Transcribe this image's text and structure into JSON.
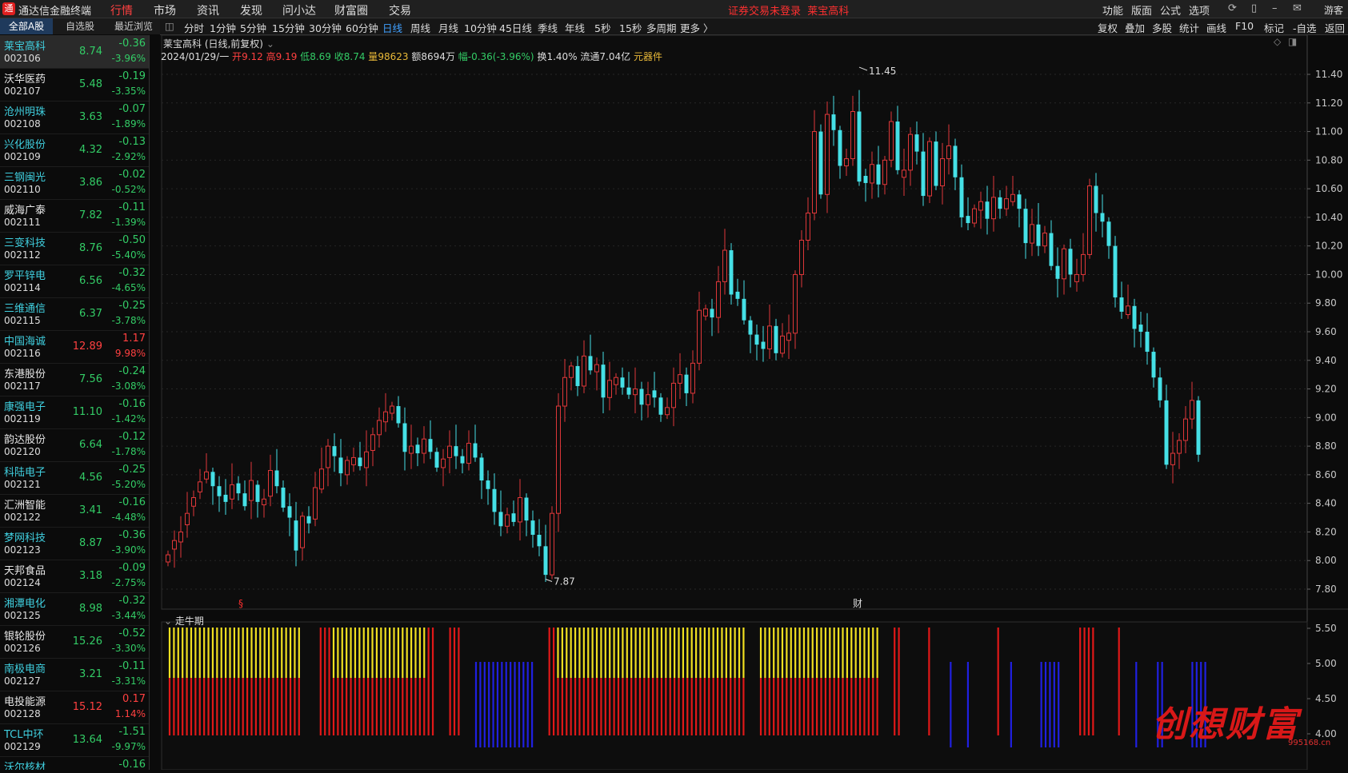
{
  "app": {
    "title": "通达信金融终端",
    "notice": "证券交易未登录",
    "notice_stock": "莱宝高科",
    "guest": "游客"
  },
  "menu": [
    "行情",
    "市场",
    "资讯",
    "发现",
    "问小达",
    "财富圈",
    "交易"
  ],
  "right_menu": [
    "功能",
    "版面",
    "公式",
    "选项"
  ],
  "list_tabs": [
    "全部A股",
    "自选股",
    "最近浏览"
  ],
  "stocks": [
    {
      "name": "莱宝高科",
      "code": "002106",
      "price": "8.74",
      "change": "-0.36",
      "pct": "-3.96%",
      "dir": "down",
      "name_color": "cyan"
    },
    {
      "name": "沃华医药",
      "code": "002107",
      "price": "5.48",
      "change": "-0.19",
      "pct": "-3.35%",
      "dir": "down",
      "name_color": "white"
    },
    {
      "name": "沧州明珠",
      "code": "002108",
      "price": "3.63",
      "change": "-0.07",
      "pct": "-1.89%",
      "dir": "down",
      "name_color": "cyan"
    },
    {
      "name": "兴化股份",
      "code": "002109",
      "price": "4.32",
      "change": "-0.13",
      "pct": "-2.92%",
      "dir": "down",
      "name_color": "cyan"
    },
    {
      "name": "三钢闽光",
      "code": "002110",
      "price": "3.86",
      "change": "-0.02",
      "pct": "-0.52%",
      "dir": "down",
      "name_color": "cyan"
    },
    {
      "name": "威海广泰",
      "code": "002111",
      "price": "7.82",
      "change": "-0.11",
      "pct": "-1.39%",
      "dir": "down",
      "name_color": "white"
    },
    {
      "name": "三变科技",
      "code": "002112",
      "price": "8.76",
      "change": "-0.50",
      "pct": "-5.40%",
      "dir": "down",
      "name_color": "cyan"
    },
    {
      "name": "罗平锌电",
      "code": "002114",
      "price": "6.56",
      "change": "-0.32",
      "pct": "-4.65%",
      "dir": "down",
      "name_color": "cyan"
    },
    {
      "name": "三维通信",
      "code": "002115",
      "price": "6.37",
      "change": "-0.25",
      "pct": "-3.78%",
      "dir": "down",
      "name_color": "cyan"
    },
    {
      "name": "中国海诚",
      "code": "002116",
      "price": "12.89",
      "change": "1.17",
      "pct": "9.98%",
      "dir": "up",
      "name_color": "cyan"
    },
    {
      "name": "东港股份",
      "code": "002117",
      "price": "7.56",
      "change": "-0.24",
      "pct": "-3.08%",
      "dir": "down",
      "name_color": "white"
    },
    {
      "name": "康强电子",
      "code": "002119",
      "price": "11.10",
      "change": "-0.16",
      "pct": "-1.42%",
      "dir": "down",
      "name_color": "cyan"
    },
    {
      "name": "韵达股份",
      "code": "002120",
      "price": "6.64",
      "change": "-0.12",
      "pct": "-1.78%",
      "dir": "down",
      "name_color": "white"
    },
    {
      "name": "科陆电子",
      "code": "002121",
      "price": "4.56",
      "change": "-0.25",
      "pct": "-5.20%",
      "dir": "down",
      "name_color": "cyan"
    },
    {
      "name": "汇洲智能",
      "code": "002122",
      "price": "3.41",
      "change": "-0.16",
      "pct": "-4.48%",
      "dir": "down",
      "name_color": "white"
    },
    {
      "name": "梦网科技",
      "code": "002123",
      "price": "8.87",
      "change": "-0.36",
      "pct": "-3.90%",
      "dir": "down",
      "name_color": "cyan"
    },
    {
      "name": "天邦食品",
      "code": "002124",
      "price": "3.18",
      "change": "-0.09",
      "pct": "-2.75%",
      "dir": "down",
      "name_color": "white"
    },
    {
      "name": "湘潭电化",
      "code": "002125",
      "price": "8.98",
      "change": "-0.32",
      "pct": "-3.44%",
      "dir": "down",
      "name_color": "cyan"
    },
    {
      "name": "银轮股份",
      "code": "002126",
      "price": "15.26",
      "change": "-0.52",
      "pct": "-3.30%",
      "dir": "down",
      "name_color": "white"
    },
    {
      "name": "南极电商",
      "code": "002127",
      "price": "3.21",
      "change": "-0.11",
      "pct": "-3.31%",
      "dir": "down",
      "name_color": "cyan"
    },
    {
      "name": "电投能源",
      "code": "002128",
      "price": "15.12",
      "change": "0.17",
      "pct": "1.14%",
      "dir": "up",
      "name_color": "white"
    },
    {
      "name": "TCL中环",
      "code": "002129",
      "price": "13.64",
      "change": "-1.51",
      "pct": "-9.97%",
      "dir": "down",
      "name_color": "cyan"
    },
    {
      "name": "沃尔核材",
      "code": "",
      "price": "",
      "change": "-0.16",
      "pct": "",
      "dir": "down",
      "name_color": "cyan"
    }
  ],
  "periods": [
    "分时",
    "1分钟",
    "5分钟",
    "15分钟",
    "30分钟",
    "60分钟",
    "日线",
    "周线",
    "月线",
    "10分钟",
    "45日线",
    "季线",
    "年线",
    "5秒",
    "15秒",
    "多周期",
    "更多 〉"
  ],
  "active_period": "日线",
  "toolbar_right": [
    "复权",
    "叠加",
    "多股",
    "统计",
    "画线",
    "F10",
    "标记",
    "-自选",
    "返回"
  ],
  "chart_title": "莱宝高科 (日线,前复权)",
  "info": {
    "date": "2024/01/29/一",
    "open_label": "开",
    "open": "9.12",
    "high_label": "高",
    "high": "9.19",
    "low_label": "低",
    "low": "8.69",
    "close_label": "收",
    "close": "8.74",
    "vol_label": "量",
    "vol": "98623",
    "amt_label": "额",
    "amt": "8694万",
    "amp_label": "幅",
    "amp": "-0.36(-3.96%)",
    "turn_label": "换",
    "turn": "1.40%",
    "float_label": "流通",
    "float": "7.04亿",
    "sector": "元器件"
  },
  "indicator": {
    "name": "走牛期",
    "ticks": [
      "5.50",
      "5.00",
      "4.50",
      "4.00"
    ]
  },
  "markers": {
    "s": "§",
    "cai": "财"
  },
  "watermark": {
    "text": "创想财富",
    "url": "995168.cn"
  },
  "chart_data": {
    "type": "candlestick",
    "ylim": [
      7.72,
      11.62
    ],
    "yticks": [
      "11.40",
      "11.20",
      "11.00",
      "10.80",
      "10.60",
      "10.40",
      "10.20",
      "10.00",
      "9.80",
      "9.60",
      "9.40",
      "9.20",
      "9.00",
      "8.80",
      "8.60",
      "8.40",
      "8.20",
      "8.00",
      "7.80"
    ],
    "annotations": [
      {
        "label": "11.45",
        "value": 11.45
      },
      {
        "label": "7.87",
        "value": 7.87
      }
    ],
    "closes": [
      8.04,
      8.14,
      8.2,
      8.33,
      8.44,
      8.55,
      8.62,
      8.52,
      8.45,
      8.41,
      8.53,
      8.47,
      8.38,
      8.56,
      8.41,
      8.43,
      8.63,
      8.52,
      8.37,
      8.3,
      8.07,
      8.31,
      8.26,
      8.51,
      8.64,
      8.8,
      8.73,
      8.61,
      8.7,
      8.72,
      8.66,
      8.76,
      8.88,
      8.98,
      9.04,
      9.08,
      8.96,
      8.76,
      8.8,
      8.75,
      8.85,
      8.76,
      8.65,
      8.71,
      8.8,
      8.73,
      8.68,
      8.82,
      8.72,
      8.56,
      8.5,
      8.34,
      8.24,
      8.32,
      8.27,
      8.44,
      8.28,
      8.18,
      8.1,
      7.9,
      8.33,
      9.08,
      9.28,
      9.36,
      9.22,
      9.43,
      9.33,
      9.37,
      9.14,
      9.26,
      9.28,
      9.21,
      9.16,
      9.2,
      9.09,
      9.16,
      9.14,
      9.02,
      9.07,
      9.24,
      9.3,
      9.17,
      9.38,
      9.75,
      9.76,
      9.7,
      9.95,
      10.17,
      9.86,
      9.83,
      9.68,
      9.58,
      9.51,
      9.48,
      9.64,
      9.45,
      9.57,
      9.59,
      10.0,
      10.24,
      10.43,
      11.0,
      10.56,
      11.12,
      11.01,
      10.76,
      10.81,
      11.14,
      10.65,
      10.64,
      10.77,
      10.63,
      10.8,
      11.07,
      10.73,
      10.73,
      10.98,
      10.86,
      10.55,
      10.93,
      10.62,
      10.81,
      10.9,
      10.68,
      10.4,
      10.36,
      10.46,
      10.51,
      10.39,
      10.54,
      10.46,
      10.53,
      10.56,
      10.46,
      10.22,
      10.35,
      10.2,
      10.29,
      10.06,
      9.97,
      10.18,
      10.0,
      10.0,
      10.14,
      10.62,
      10.43,
      10.37,
      10.2,
      9.84,
      9.74,
      9.78,
      9.62,
      9.6,
      9.46,
      9.28,
      9.12,
      8.67,
      8.75,
      8.84,
      8.99,
      9.12,
      8.74
    ],
    "oc_gap": [
      0.05,
      0.06,
      0.07,
      0.08,
      0.06,
      0.07,
      0.05,
      0.1,
      0.07,
      0.05,
      0.1,
      0.07,
      0.09,
      0.14,
      0.12,
      0.04,
      0.18,
      0.11,
      0.14,
      0.08,
      0.21,
      0.22,
      0.05,
      0.22,
      0.14,
      0.15,
      0.07,
      0.11,
      0.1,
      0.05,
      0.06,
      0.11,
      0.11,
      0.1,
      0.07,
      0.05,
      0.12,
      0.2,
      0.05,
      0.06,
      0.1,
      0.09,
      0.11,
      0.06,
      0.08,
      0.07,
      0.05,
      0.14,
      0.1,
      0.16,
      0.06,
      0.16,
      0.1,
      0.08,
      0.06,
      0.17,
      0.16,
      0.1,
      0.08,
      0.2,
      0.43,
      0.75,
      0.2,
      0.08,
      0.14,
      0.21,
      0.1,
      0.05,
      0.23,
      0.12,
      0.05,
      0.07,
      0.05,
      0.04,
      0.11,
      0.07,
      0.05,
      0.12,
      0.05,
      0.17,
      0.06,
      0.13,
      0.21,
      0.37,
      0.05,
      0.06,
      0.25,
      0.22,
      0.31,
      0.05,
      0.15,
      0.1,
      0.07,
      0.05,
      0.16,
      0.19,
      0.12,
      0.05,
      0.41,
      0.24,
      0.19,
      0.57,
      0.44,
      0.56,
      0.11,
      0.25,
      0.05,
      0.33,
      0.49,
      0.05,
      0.13,
      0.14,
      0.17,
      0.27,
      0.34,
      0.05,
      0.25,
      0.12,
      0.31,
      0.38,
      0.31,
      0.19,
      0.09,
      0.22,
      0.28,
      0.05,
      0.1,
      0.06,
      0.12,
      0.15,
      0.08,
      0.07,
      0.05,
      0.1,
      0.24,
      0.13,
      0.15,
      0.09,
      0.23,
      0.09,
      0.21,
      0.18,
      0.05,
      0.14,
      0.48,
      0.19,
      0.06,
      0.17,
      0.36,
      0.1,
      0.06,
      0.16,
      0.05,
      0.14,
      0.18,
      0.16,
      0.45,
      0.08,
      0.09,
      0.15,
      0.13,
      0.38
    ],
    "indicator_pattern": "YYYYYYYYYYYYYYYYYYYYYYYYYYYYYYY____RRRYYYYYYYYYYYYYYYYYYYYYYRR___RRR___BBBBBBBBBBBBBB___RRYYYYYYYYYYYYYYYYYYYYYYYYYYYYYYYYYYYYYYYYYYYY___YYYYYYYYYYYYYYYYYYYYYYYYYYYY___RR______R____B___B______R__B______BBBBB____RRRR_____R___B____BB______BBBB"
  }
}
